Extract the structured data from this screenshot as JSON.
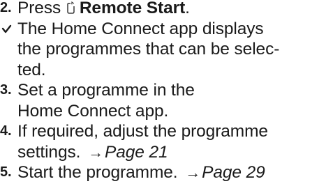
{
  "steps": [
    {
      "number": "2.",
      "prefix": "Press ",
      "button_label": "Remote Start",
      "suffix": ".",
      "icon": "remote-start-icon"
    },
    {
      "marker": "result-checkmark",
      "line1": "The Home Connect app displays",
      "line2": "the programmes that can be selec-",
      "line3": "ted."
    },
    {
      "number": "3.",
      "line1": "Set a programme in the",
      "line2": "Home Connect app."
    },
    {
      "number": "4.",
      "line1": "If required, adjust the programme",
      "line2_text": "settings. ",
      "arrow": "→",
      "link": "Page 21"
    },
    {
      "number": "5.",
      "text": "Start the programme. ",
      "arrow": "→",
      "link": "Page 29"
    }
  ]
}
